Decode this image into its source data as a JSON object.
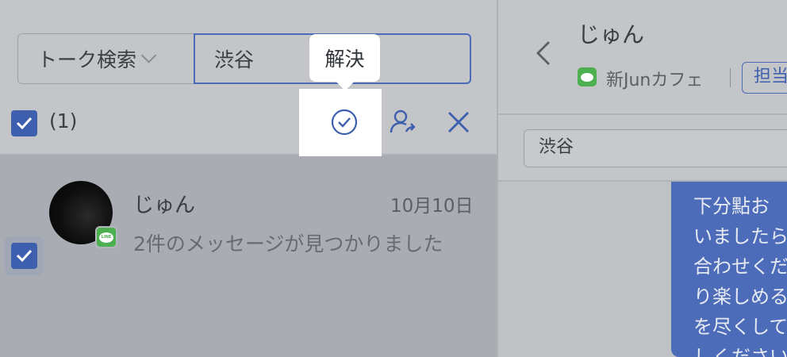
{
  "search": {
    "type_label": "トーク検索",
    "query": "渋谷"
  },
  "tooltip": {
    "label": "解決"
  },
  "selection": {
    "count_label": "(1)"
  },
  "actions": {
    "resolve": "resolve",
    "assign": "assign",
    "close": "close"
  },
  "conversations": [
    {
      "name": "じゅん",
      "date": "10月10日",
      "preview": "2件のメッセージが見つかりました",
      "channel": "LINE",
      "selected": true
    }
  ],
  "detail": {
    "name": "じゅん",
    "channel_name": "新Junカフェ",
    "tag_label": "担当",
    "search_query": "渋谷",
    "message_lines": [
      "下分點お",
      "いましたら",
      "合わせくだ",
      "り楽しめる",
      "を尽くして",
      "しください"
    ]
  },
  "colors": {
    "accent": "#3e5fae",
    "line_green": "#4caf50",
    "message_bubble": "#4c6cb9"
  }
}
